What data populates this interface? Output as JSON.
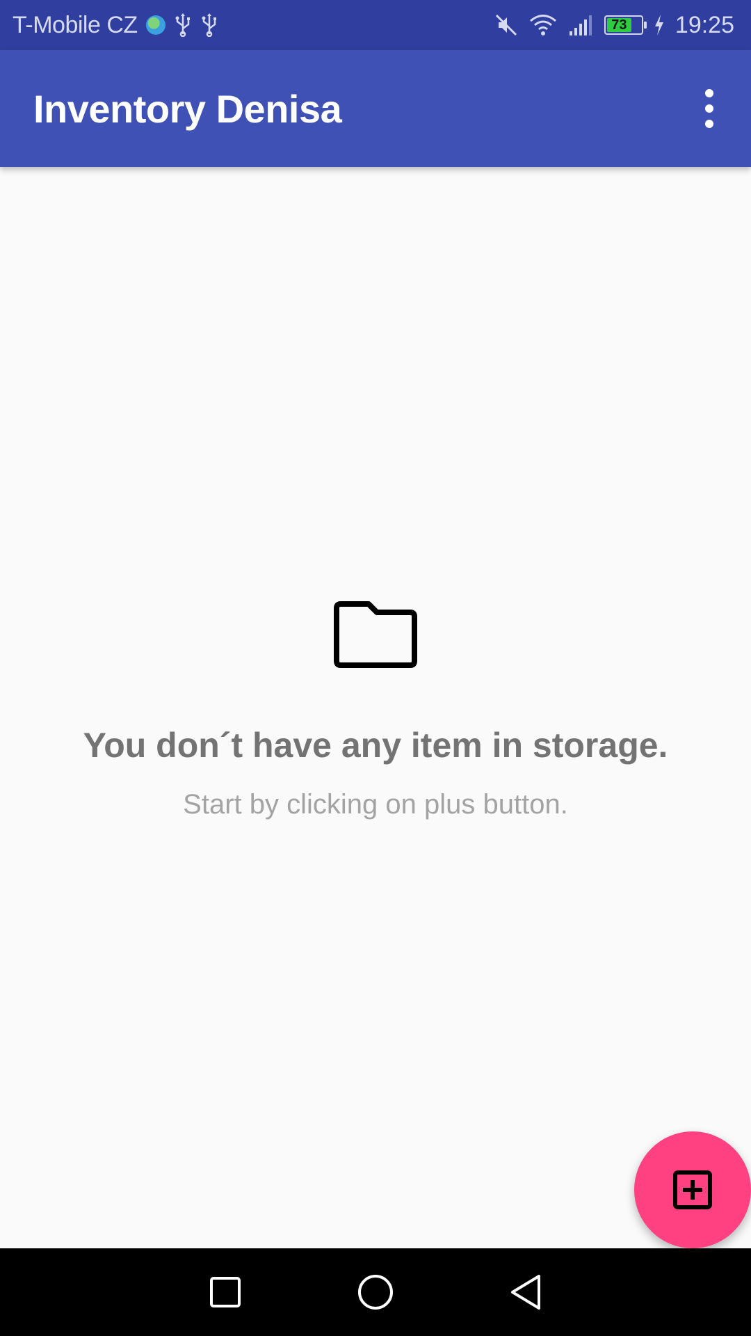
{
  "status_bar": {
    "carrier": "T-Mobile CZ",
    "battery_level": "73",
    "battery_color": "#2ecc40",
    "time": "19:25",
    "icons": [
      "globe-icon",
      "usb-icon",
      "usb-icon",
      "mute-icon",
      "wifi-icon",
      "signal-icon",
      "battery-icon",
      "charging-icon"
    ]
  },
  "app_bar": {
    "title": "Inventory Denisa",
    "background": "#3f51b5",
    "menu_icon": "more-vert-icon"
  },
  "empty_state": {
    "icon": "folder-icon",
    "title": "You don´t have any item in storage.",
    "subtitle": "Start by clicking on plus button."
  },
  "fab": {
    "icon": "add-box-icon",
    "color": "#ff4081"
  },
  "nav_bar": {
    "buttons": [
      "recents-icon",
      "home-icon",
      "back-icon"
    ]
  }
}
